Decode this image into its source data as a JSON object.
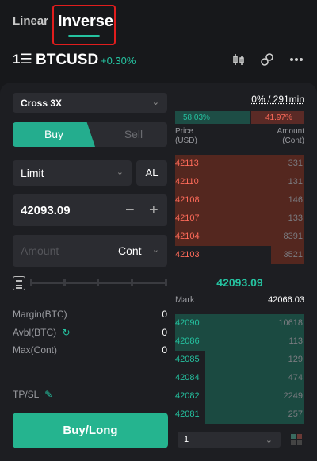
{
  "tabs": {
    "linear": "Linear",
    "inverse": "Inverse"
  },
  "header": {
    "icon": "book-icon",
    "symbol": "BTCUSD",
    "change": "+0.30%"
  },
  "form": {
    "margin_mode": "Cross 3X",
    "buy_label": "Buy",
    "sell_label": "Sell",
    "order_type": "Limit",
    "al_label": "AL",
    "price_value": "42093.09",
    "amount_placeholder": "Amount",
    "amount_unit": "Cont",
    "margin_label": "Margin(BTC)",
    "margin_value": "0",
    "avbl_label": "Avbl(BTC)",
    "avbl_value": "0",
    "max_label": "Max(Cont)",
    "max_value": "0",
    "tpsl_label": "TP/SL",
    "submit_label": "Buy/Long"
  },
  "orderbook": {
    "title": "0% / 291min",
    "buy_ratio": "58.03%",
    "sell_ratio": "41.97%",
    "price_header": [
      "Price",
      "(USD)"
    ],
    "amount_header": [
      "Amount",
      "(Cont)"
    ],
    "asks": [
      {
        "price": "42113",
        "amount": "331",
        "depth": 1.0
      },
      {
        "price": "42110",
        "amount": "131",
        "depth": 1.0
      },
      {
        "price": "42108",
        "amount": "146",
        "depth": 1.0
      },
      {
        "price": "42107",
        "amount": "133",
        "depth": 1.0
      },
      {
        "price": "42104",
        "amount": "8391",
        "depth": 1.0
      },
      {
        "price": "42103",
        "amount": "3521",
        "depth": 0.26
      }
    ],
    "mid_price": "42093.09",
    "mark_label": "Mark",
    "mark_value": "42066.03",
    "bids": [
      {
        "price": "42090",
        "amount": "10618",
        "depth": 1.0
      },
      {
        "price": "42086",
        "amount": "113",
        "depth": 1.0
      },
      {
        "price": "42085",
        "amount": "129",
        "depth": 0.77
      },
      {
        "price": "42084",
        "amount": "474",
        "depth": 0.77
      },
      {
        "price": "42082",
        "amount": "2249",
        "depth": 0.77
      },
      {
        "price": "42081",
        "amount": "257",
        "depth": 0.77
      }
    ],
    "depth_select": "1"
  },
  "colors": {
    "accent": "#25c2a0",
    "sell": "#ff6b5a",
    "highlight_box": "#e11d1d"
  }
}
